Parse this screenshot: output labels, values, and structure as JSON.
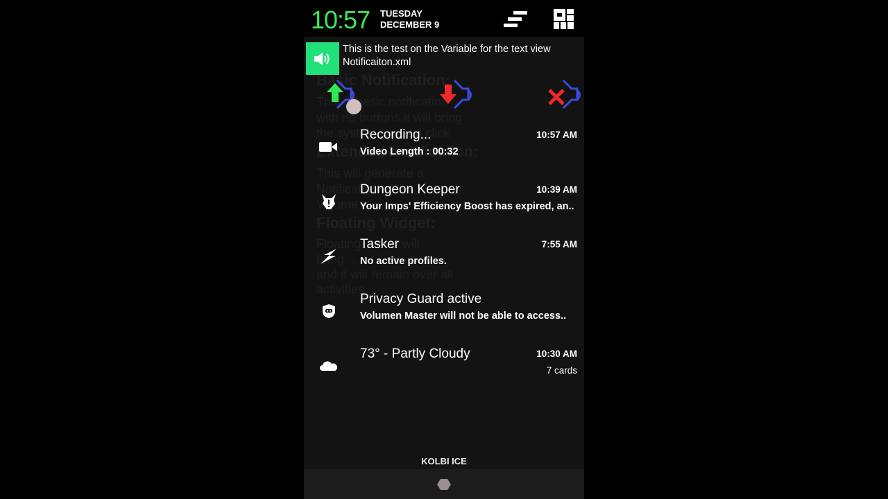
{
  "status_bar": {
    "time": "10:57",
    "weekday": "TUESDAY",
    "date": "DECEMBER 9",
    "icons": [
      "quick-settings-icon",
      "tiles-grid-icon"
    ],
    "clock_color": "#3ee65a"
  },
  "toast": {
    "icon": "speaker-icon",
    "line1": "This is the test on the Variable for the text view",
    "line2": "Notificaiton.xml",
    "accent": "#22e07a"
  },
  "volume_buttons": [
    {
      "name": "volume-up",
      "color": "#2ee85a"
    },
    {
      "name": "volume-down",
      "color": "#ee2a2a"
    },
    {
      "name": "volume-mute",
      "color": "#ee2a2a"
    }
  ],
  "background_app": {
    "headings": [
      "Basic Notification:",
      "Extended Notification:",
      "Floating Widget:"
    ],
    "texts": [
      "This is basic notification",
      "with no buttons.it will bring",
      "the system to ... on click",
      "This will generate a",
      "Notification ...",
      "Volume ...",
      "Floating ... that will",
      "bring ...",
      "and it will remain over all",
      "activities."
    ]
  },
  "notifications": [
    {
      "icon": "video-camera-icon",
      "title": "Recording...",
      "text": "Video Length : 00:32",
      "time": "10:57 AM"
    },
    {
      "icon": "dungeon-keeper-icon",
      "title": "Dungeon Keeper",
      "text": "Your Imps' Efficiency Boost has expired, an..",
      "time": "10:39 AM"
    },
    {
      "icon": "lightning-icon",
      "title": "Tasker",
      "text": "No active profiles.",
      "time": "7:55 AM"
    },
    {
      "icon": "privacy-guard-shield-icon",
      "title": "Privacy Guard active",
      "text": "Volumen Master will not be able to access.."
    },
    {
      "icon": "cloud-icon",
      "title": "73° - Partly Cloudy",
      "time": "10:30 AM",
      "extra": "7 cards"
    }
  ],
  "carrier": "KOLBI ICE"
}
